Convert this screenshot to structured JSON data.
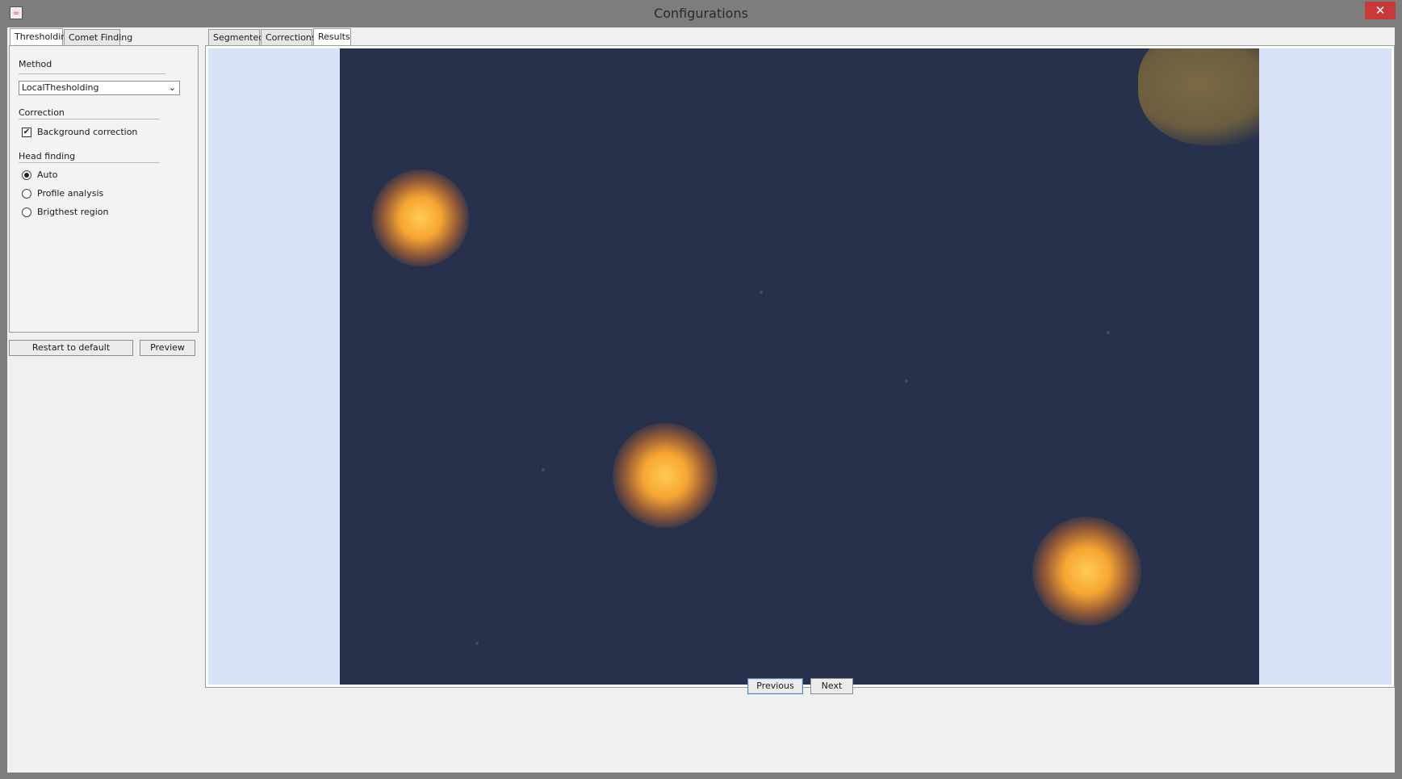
{
  "window": {
    "title": "Configurations",
    "close_glyph": "✕",
    "app_icon": "java-cup-icon"
  },
  "left_tabs": [
    {
      "label": "Thresholding",
      "active": true
    },
    {
      "label": "Comet Finding",
      "active": false
    }
  ],
  "thresholding": {
    "method_label": "Method",
    "method_value": "LocalThesholding",
    "correction_label": "Correction",
    "background_correction_label": "Background correction",
    "background_correction_checked": true,
    "head_finding_label": "Head finding",
    "radios": [
      {
        "label": "Auto",
        "selected": true
      },
      {
        "label": "Profile analysis",
        "selected": false
      },
      {
        "label": "Brigthest region",
        "selected": false
      }
    ]
  },
  "buttons": {
    "restart": "Restart to default",
    "preview": "Preview",
    "previous": "Previous",
    "next": "Next"
  },
  "right_tabs": [
    {
      "label": "Segmented",
      "active": false
    },
    {
      "label": "Corrections",
      "active": false
    },
    {
      "label": "Results",
      "active": true
    }
  ],
  "colors": {
    "title_bar": "#7d7d7d",
    "close_button": "#c8393a",
    "image_background": "#27314b",
    "image_frame": "#d7e2f7",
    "comet_core": "#ffcc55"
  }
}
